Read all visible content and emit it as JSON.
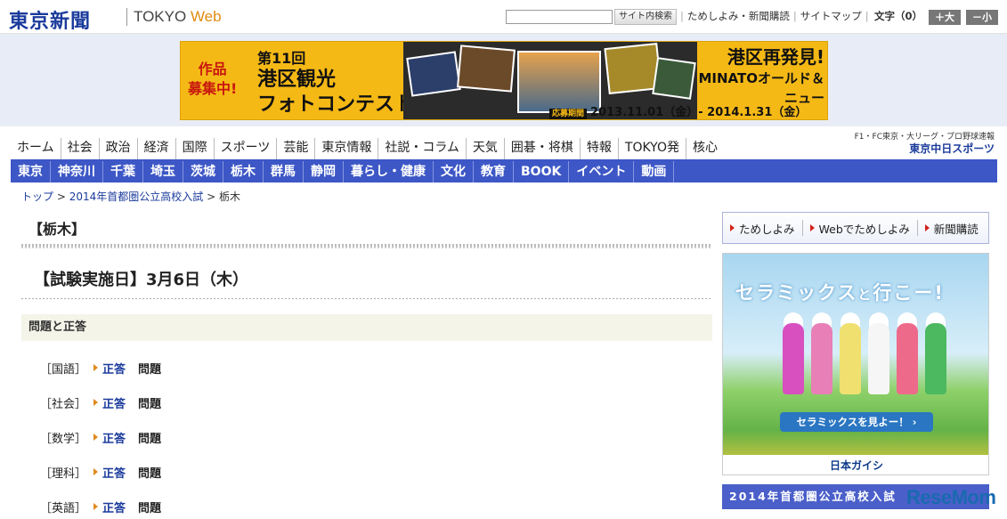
{
  "header": {
    "logo": "東京新聞",
    "logo_sub_1": "TOKYO",
    "logo_sub_2": "Web",
    "search_button": "サイト内検索",
    "links": [
      "ためしよみ・新聞購読",
      "サイトマップ"
    ],
    "font_size_label": "文字（0）",
    "font_bigger": "＋大",
    "font_smaller": "－小"
  },
  "banner": {
    "left_1": "作品",
    "left_2": "募集中!",
    "mid_num": "第11回",
    "mid_t1": "港区観光",
    "mid_t2": "フォトコンテスト",
    "right_1": "港区再発見!",
    "right_2": "MINATOオールド＆ニュー",
    "period_label": "応募期間",
    "period": "2013.11.01（金）- 2014.1.31（金）",
    "photo_label": "MINATO-PHOTO"
  },
  "main_nav": [
    "ホーム",
    "社会",
    "政治",
    "経済",
    "国際",
    "スポーツ",
    "芸能",
    "東京情報",
    "社説・コラム",
    "天気",
    "囲碁・将棋",
    "特報",
    "TOKYO発",
    "核心"
  ],
  "chunichi": {
    "line1": "F1・FC東京・大リーグ・プロ野球速報",
    "line2": "東京中日スポーツ"
  },
  "sub_nav": [
    "東京",
    "神奈川",
    "千葉",
    "埼玉",
    "茨城",
    "栃木",
    "群馬",
    "静岡",
    "暮らし・健康",
    "文化",
    "教育",
    "BOOK",
    "イベント",
    "動画"
  ],
  "breadcrumb": {
    "home": "トップ",
    "sep": " > ",
    "parent": "2014年首都圏公立高校入試",
    "current": "栃木"
  },
  "content": {
    "title": "【栃木】",
    "exam_date": "【試験実施日】3月6日（木）",
    "section": "問題と正答",
    "subjects": [
      {
        "name": "［国語］",
        "answer": "正答",
        "question": "問題"
      },
      {
        "name": "［社会］",
        "answer": "正答",
        "question": "問題"
      },
      {
        "name": "［数学］",
        "answer": "正答",
        "question": "問題"
      },
      {
        "name": "［理科］",
        "answer": "正答",
        "question": "問題"
      },
      {
        "name": "［英語］",
        "answer": "正答",
        "question": "問題"
      }
    ]
  },
  "sidebar": {
    "trial_links": [
      "ためしよみ",
      "Webでためしよみ",
      "新聞購読"
    ],
    "ad_headline_1": "セラミックス",
    "ad_headline_2": "と",
    "ad_headline_3": "行こー!",
    "ad_cta": "セラミックスを見よー！ ›",
    "ad_brand": "日本ガイシ",
    "section_title": "2014年首都圏公立高校入試",
    "watermark": "ReseMom"
  },
  "colors": {
    "brand_blue": "#1b3b9c",
    "nav_blue": "#3d57c6",
    "banner_yellow": "#f5b916",
    "arrow_orange": "#e08a1e"
  }
}
